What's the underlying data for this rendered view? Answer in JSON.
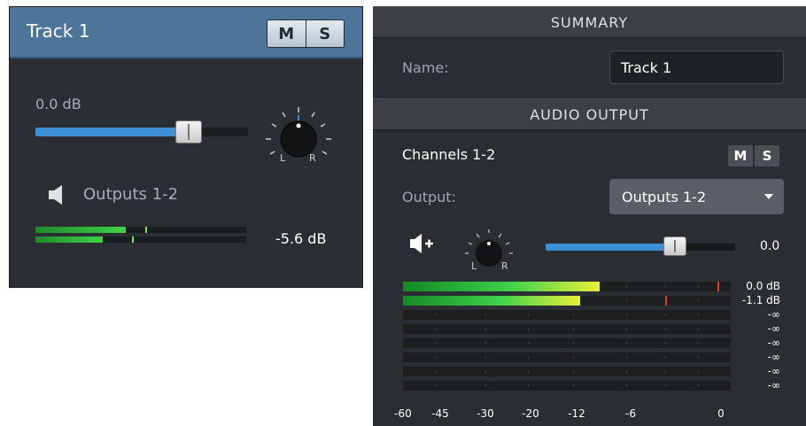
{
  "track": {
    "title": "Track 1",
    "mute_label": "M",
    "solo_label": "S",
    "gain_label": "0.0 dB",
    "fader_level": 0.72,
    "pan_left_label": "L",
    "pan_right_label": "R",
    "output_icon": "speaker-icon",
    "output_label": "Outputs 1-2",
    "meters": [
      {
        "level": 0.43,
        "peak": 0.52
      },
      {
        "level": 0.32,
        "peak": 0.46
      }
    ],
    "level_label": "-5.6 dB"
  },
  "inspector": {
    "summary_header": "SUMMARY",
    "name_label": "Name:",
    "name_value": "Track 1",
    "audio_output_header": "AUDIO OUTPUT",
    "channels_label": "Channels 1-2",
    "mute_label": "M",
    "solo_label": "S",
    "output_label": "Output:",
    "output_value": "Outputs 1-2",
    "add_output_icon": "speaker-add-icon",
    "pan_left_label": "L",
    "pan_right_label": "R",
    "gain_value": "0.0",
    "fader_level": 0.68,
    "meters": [
      {
        "level": 0.6,
        "peak": 0.96,
        "value": "0.0 dB",
        "color": "yellow"
      },
      {
        "level": 0.54,
        "peak": 0.8,
        "value": "-1.1 dB",
        "color": "yellow"
      },
      {
        "level": 0,
        "value": "-∞"
      },
      {
        "level": 0,
        "value": "-∞"
      },
      {
        "level": 0,
        "value": "-∞"
      },
      {
        "level": 0,
        "value": "-∞"
      },
      {
        "level": 0,
        "value": "-∞"
      },
      {
        "level": 0,
        "value": "-∞"
      }
    ],
    "scale": [
      "-60",
      "-45",
      "-30",
      "-20",
      "-12",
      "-6",
      "0"
    ]
  },
  "colors": {
    "header_blue": "#4d7599",
    "fader_blue": "#3d8fd6",
    "meter_green": "#3fd24a",
    "meter_yellow": "#e8f03a",
    "peak_red": "#e03a2a"
  }
}
